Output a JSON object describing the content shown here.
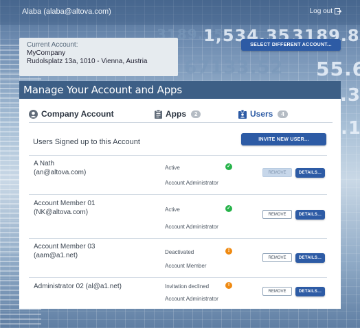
{
  "header": {
    "user_label": "Alaba (alaba@altova.com)",
    "logout_label": "Log out"
  },
  "background_numbers": [
    "3189.35",
    "1,534.35",
    "3189.8",
    "67133.52",
    "55.67",
    ".30",
    ".13"
  ],
  "current_account": {
    "label": "Current Account:",
    "company": "MyCompany",
    "address": "Rudolsplatz 13a, 1010 - Vienna, Austria",
    "select_button": "SELECT DIFFERENT ACCOUNT..."
  },
  "panel": {
    "title": "Manage Your Account and Apps",
    "tabs": [
      {
        "label": "Company Account",
        "icon": "account-circle-icon",
        "count": null,
        "active": false
      },
      {
        "label": "Apps",
        "icon": "clipboard-icon",
        "count": "2",
        "active": false
      },
      {
        "label": "Users",
        "icon": "user-badge-icon",
        "count": "4",
        "active": true
      }
    ],
    "section_title": "Users Signed up to this Account",
    "invite_button": "INVITE NEW USER..."
  },
  "users": [
    {
      "name": "A Nath",
      "email": "(an@altova.com)",
      "status": "Active",
      "status_type": "ok",
      "role": "Account Administrator",
      "remove_label": "REMOVE",
      "remove_disabled": true,
      "details_label": "DETAILS..."
    },
    {
      "name": "Account Member 01",
      "email": "(NK@altova.com)",
      "status": "Active",
      "status_type": "ok",
      "role": "Account Administrator",
      "remove_label": "REMOVE",
      "remove_disabled": false,
      "details_label": "DETAILS..."
    },
    {
      "name": "Account Member 03",
      "email": "(aam@a1.net)",
      "status": "Deactivated",
      "status_type": "warn",
      "role": "Account Member",
      "remove_label": "REMOVE",
      "remove_disabled": false,
      "details_label": "DETAILS..."
    },
    {
      "name": "Administrator 02 (al@a1.net)",
      "email": "",
      "status": "Invitation declined",
      "status_type": "warn",
      "role": "Account Administrator",
      "remove_label": "REMOVE",
      "remove_disabled": false,
      "details_label": "DETAILS..."
    }
  ],
  "colors": {
    "primary_button": "#2d5ba5",
    "header_bar": "#3d5f86",
    "status_ok": "#27b34a",
    "status_warn": "#ef8a12"
  }
}
